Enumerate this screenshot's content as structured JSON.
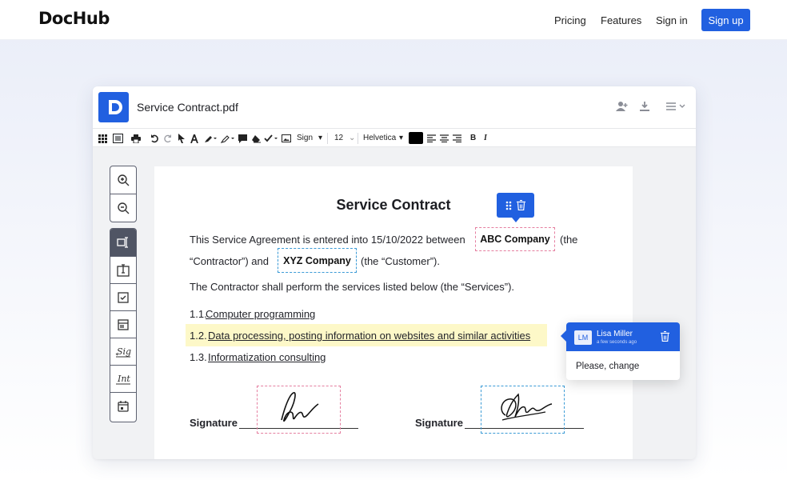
{
  "nav": {
    "logo": "DocHub",
    "links": [
      "Pricing",
      "Features",
      "Sign in"
    ],
    "cta": "Sign up"
  },
  "editor": {
    "filename": "Service Contract.pdf",
    "toolbar": {
      "sign_label": "Sign",
      "font_size": "12",
      "font_family": "Helvetica",
      "bold_label": "B",
      "italic_label": "I"
    }
  },
  "document": {
    "title": "Service Contract",
    "p1_a": "This Service Agreement is entered into 15/10/2022 between",
    "field_abc": "ABC Company",
    "p1_b": "(the",
    "p2_a": "“Contractor”) and",
    "field_xyz": "XYZ Company",
    "p2_b": "(the “Customer”).",
    "p3": "The Contractor shall perform the services listed below (the “Services”).",
    "items": [
      {
        "num": "1.1.",
        "text": "Computer programming"
      },
      {
        "num": "1.2.",
        "text": "Data processing, posting information on websites and similar activities"
      },
      {
        "num": "1.3.",
        "text": "Informatization consulting"
      }
    ],
    "signature_label": "Signature"
  },
  "comment": {
    "initials": "LM",
    "author": "Lisa Miller",
    "time": "a few seconds ago",
    "text": "Please, change"
  },
  "colors": {
    "brand": "#2160e0",
    "highlight": "#fdf8c8",
    "pink_field": "#e57fa0",
    "blue_field": "#3b9bd6"
  }
}
